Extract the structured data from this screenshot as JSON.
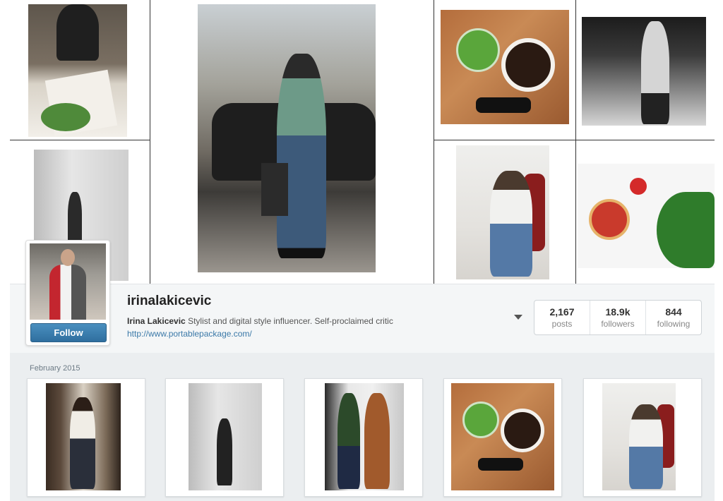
{
  "profile": {
    "username": "irinalakicevic",
    "full_name": "Irina Lakicevic",
    "bio": "Stylist and digital style influencer. Self-proclaimed critic",
    "website": "http://www.portablepackage.com/",
    "follow_label": "Follow",
    "stats": {
      "posts": {
        "value": "2,167",
        "label": "posts"
      },
      "followers": {
        "value": "18.9k",
        "label": "followers"
      },
      "following": {
        "value": "844",
        "label": "following"
      }
    }
  },
  "feed": {
    "month_label": "February 2015"
  },
  "icons": {
    "menu": "chevron-down-icon"
  },
  "colors": {
    "follow_button": "#2f6f9f",
    "link": "#3b79a8",
    "profile_bg": "#f4f6f7",
    "feed_bg": "#ebeef0"
  }
}
